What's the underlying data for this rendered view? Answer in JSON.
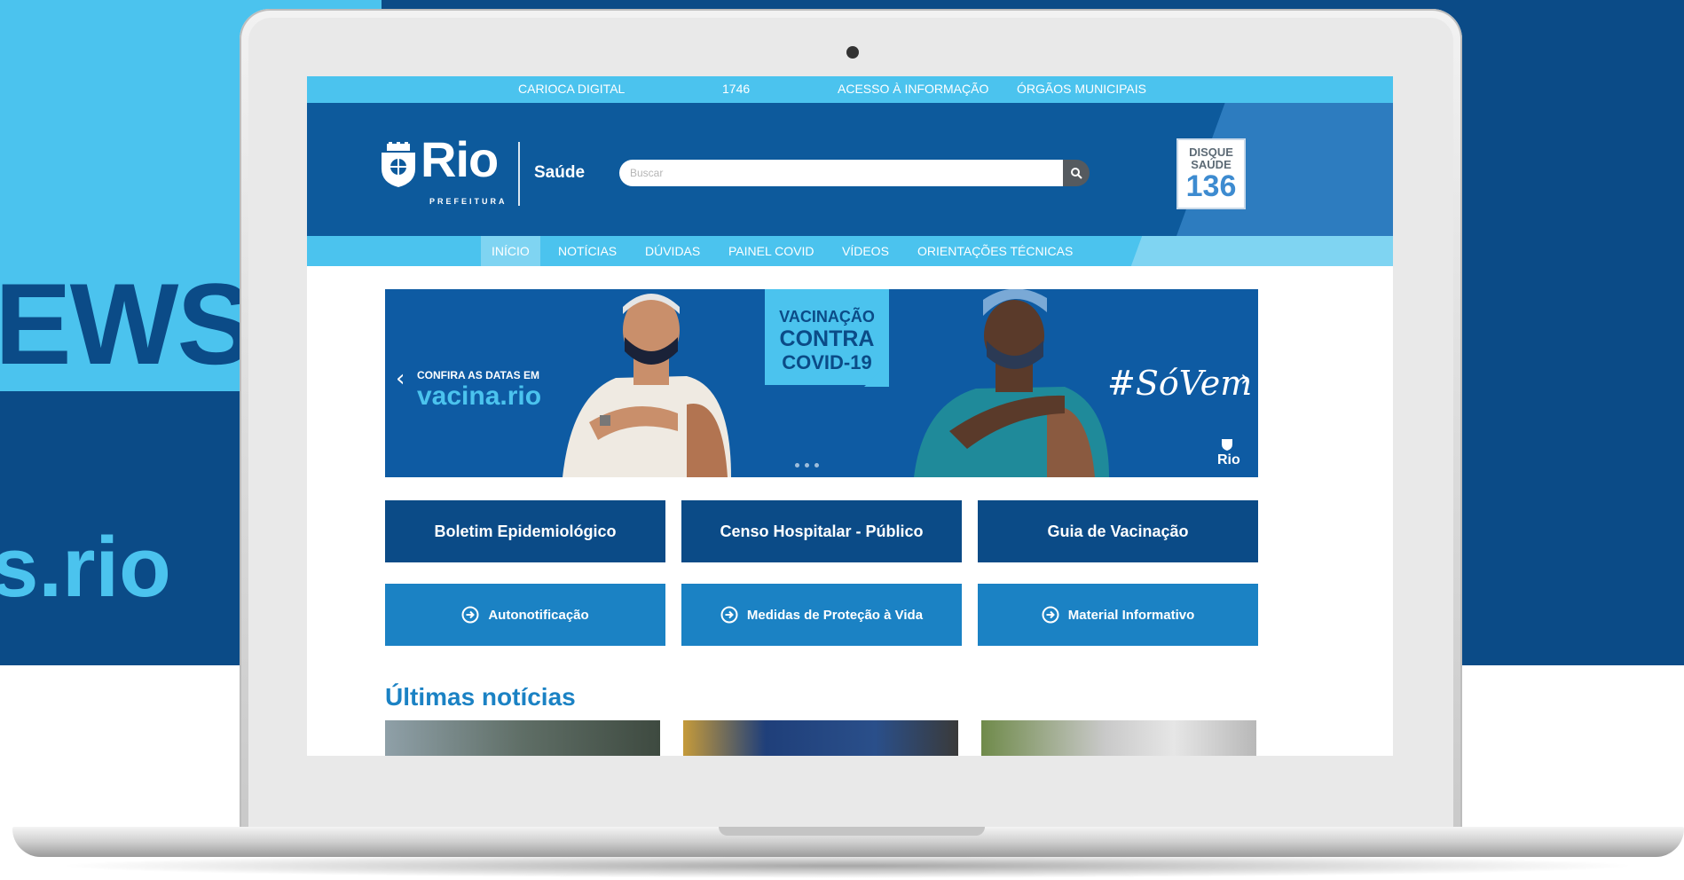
{
  "background": {
    "headline_fragment": "EWS",
    "url_fragment": "s.rio",
    "colors": {
      "navy": "#0b4b87",
      "light_blue": "#4bc3ee"
    }
  },
  "site": {
    "top_links": [
      "CARIOCA DIGITAL",
      "1746",
      "ACESSO À INFORMAÇÃO",
      "ÓRGÃOS MUNICIPAIS"
    ],
    "logo": {
      "name": "Rio",
      "sub": "PREFEITURA",
      "section": "Saúde",
      "icon": "rio-coat-of-arms-icon"
    },
    "search": {
      "placeholder": "Buscar",
      "icon": "search-icon"
    },
    "disque": {
      "line1": "DISQUE",
      "line2": "SAÚDE",
      "number": "136"
    },
    "nav_tabs": [
      {
        "label": "INÍCIO",
        "active": true
      },
      {
        "label": "NOTÍCIAS",
        "active": false
      },
      {
        "label": "DÚVIDAS",
        "active": false
      },
      {
        "label": "PAINEL COVID",
        "active": false
      },
      {
        "label": "VÍDEOS",
        "active": false
      },
      {
        "label": "ORIENTAÇÕES TÉCNICAS",
        "active": false
      }
    ],
    "banner": {
      "small_text": "CONFIRA AS DATAS EM",
      "url": "vacina.rio",
      "campaign": [
        "VACINAÇÃO",
        "CONTRA",
        "COVID-19"
      ],
      "hashtag": "#SóVem",
      "logo_text": "Rio",
      "prev_icon": "chevron-left-icon",
      "next_icon": "chevron-right-icon"
    },
    "primary_tiles": [
      "Boletim Epidemiológico",
      "Censo Hospitalar - Público",
      "Guia de Vacinação"
    ],
    "secondary_tiles": [
      {
        "label": "Autonotificação",
        "icon": "arrow-circle-right-icon"
      },
      {
        "label": "Medidas de Proteção à Vida",
        "icon": "arrow-circle-right-icon"
      },
      {
        "label": "Material Informativo",
        "icon": "arrow-circle-right-icon"
      }
    ],
    "news_heading": "Últimas notícias",
    "colors": {
      "header": "#0d5a9c",
      "strip": "#4bc3ee",
      "tile_primary": "#0b4b87",
      "tile_secondary": "#1b82c4",
      "heading": "#1b82c4"
    }
  }
}
